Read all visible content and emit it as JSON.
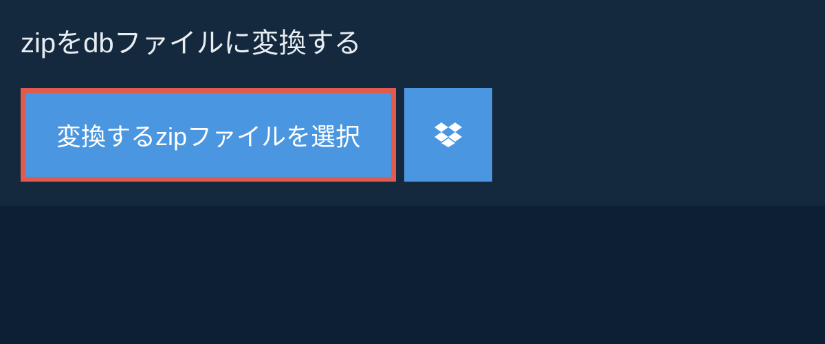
{
  "title": "zipをdbファイルに変換する",
  "select_button_label": "変換するzipファイルを選択"
}
